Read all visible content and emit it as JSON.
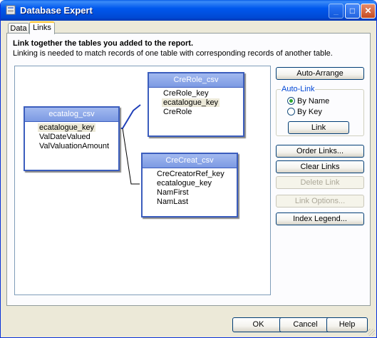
{
  "window": {
    "title": "Database Expert",
    "controls": {
      "minimize": "_",
      "maximize": "□",
      "close": "✕"
    }
  },
  "tabs": [
    {
      "label": "Data",
      "active": false
    },
    {
      "label": "Links",
      "active": true
    }
  ],
  "links_page": {
    "heading": "Link together the tables you added to the report.",
    "description": "Linking is needed to match records of one table with corresponding records of another table."
  },
  "tables": [
    {
      "name": "ecatalog_csv",
      "fields": [
        {
          "label": "ecatalogue_key",
          "highlighted": true
        },
        {
          "label": "ValDateValued",
          "highlighted": false
        },
        {
          "label": "ValValuationAmount",
          "highlighted": false
        }
      ]
    },
    {
      "name": "CreRole_csv",
      "fields": [
        {
          "label": "CreRole_key",
          "highlighted": false
        },
        {
          "label": "ecatalogue_key",
          "highlighted": true
        },
        {
          "label": "CreRole",
          "highlighted": false
        }
      ]
    },
    {
      "name": "CreCreat_csv",
      "fields": [
        {
          "label": "CreCreatorRef_key",
          "highlighted": false
        },
        {
          "label": "ecatalogue_key",
          "highlighted": false
        },
        {
          "label": "NamFirst",
          "highlighted": false
        },
        {
          "label": "NamLast",
          "highlighted": false
        }
      ]
    }
  ],
  "side_buttons": {
    "auto_arrange": "Auto-Arrange",
    "order_links": "Order Links...",
    "clear_links": "Clear Links",
    "delete_link": "Delete Link",
    "link_options": "Link Options...",
    "index_legend": "Index Legend..."
  },
  "auto_link": {
    "label": "Auto-Link",
    "options": [
      {
        "label": "By Name",
        "selected": true
      },
      {
        "label": "By Key",
        "selected": false
      }
    ],
    "link_button": "Link"
  },
  "dialog_buttons": {
    "ok": "OK",
    "cancel": "Cancel",
    "help": "Help"
  },
  "colors": {
    "titlebar": "#0058ee",
    "table_header": "#7c9ae3",
    "table_border": "#3b5dbd",
    "link_line": "#1f3fb8",
    "highlight": "#ece9d8"
  }
}
